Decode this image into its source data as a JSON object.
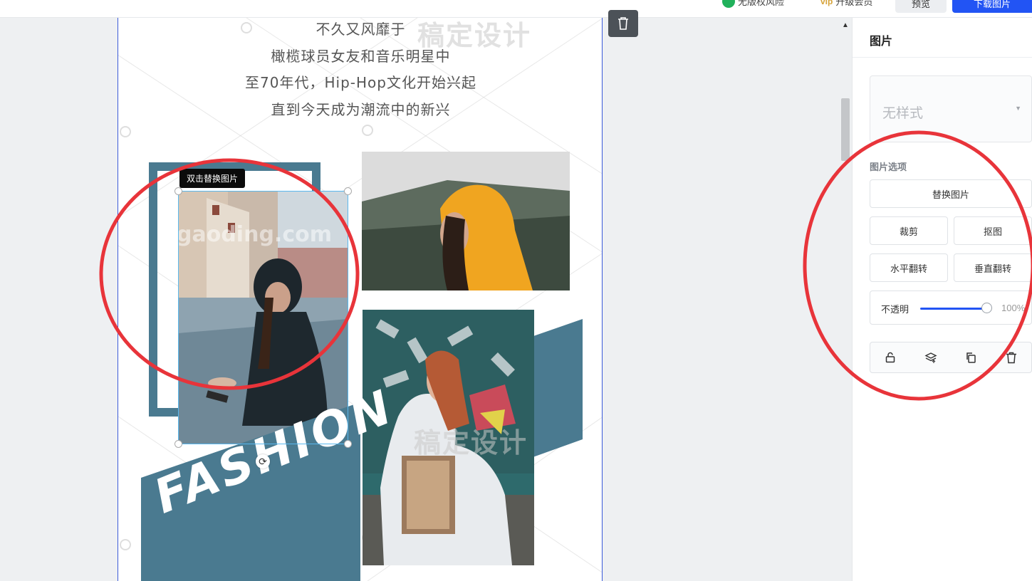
{
  "topbar": {
    "risk_label": "无版权风险",
    "vip_badge": "vip",
    "upgrade_label": "升级会员",
    "preview_label": "预览",
    "download_label": "下载图片"
  },
  "canvas": {
    "poem_lines": [
      "不久又风靡于",
      "橄榄球员女友和音乐明星中",
      "至70年代，Hip-Hop文化开始兴起",
      "直到今天成为潮流中的新兴"
    ],
    "watermark_cn": "稿定设计",
    "watermark_en": "gaoding.com",
    "fashion_text": "FASHION",
    "tooltip": "双击替换图片",
    "colors": {
      "teal": "#4a7a90",
      "selection": "#5ab9ef",
      "annotation": "#e8343a"
    }
  },
  "panel": {
    "title": "图片",
    "style_select": {
      "value": "无样式"
    },
    "section_label": "图片选项",
    "replace_label": "替换图片",
    "crop_label": "裁剪",
    "cutout_label": "抠图",
    "flip_h_label": "水平翻转",
    "flip_v_label": "垂直翻转",
    "opacity": {
      "label": "不透明",
      "value_text": "100%",
      "value": 1.0
    },
    "actions": [
      "lock-icon",
      "layers-icon",
      "copy-icon",
      "trash-icon"
    ]
  }
}
